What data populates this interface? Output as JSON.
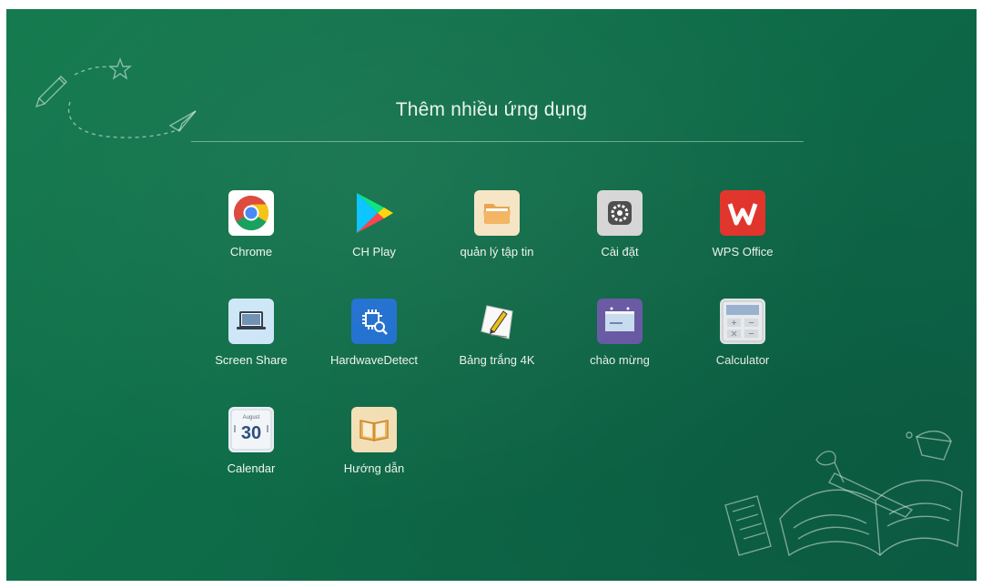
{
  "page": {
    "title": "Thêm nhiều ứng dụng"
  },
  "apps": [
    {
      "label": "Chrome",
      "icon": "chrome-icon"
    },
    {
      "label": "CH Play",
      "icon": "play-store-icon"
    },
    {
      "label": "quản lý tập tin",
      "icon": "folder-icon"
    },
    {
      "label": "Cài đặt",
      "icon": "settings-gear-icon"
    },
    {
      "label": "WPS Office",
      "icon": "wps-office-icon"
    },
    {
      "label": "Screen Share",
      "icon": "laptop-icon"
    },
    {
      "label": "HardwaveDetect",
      "icon": "chip-search-icon"
    },
    {
      "label": "Bảng trắng 4K",
      "icon": "whiteboard-pencil-icon"
    },
    {
      "label": "chào mừng",
      "icon": "welcome-board-icon"
    },
    {
      "label": "Calculator",
      "icon": "calculator-icon"
    },
    {
      "label": "Calendar",
      "icon": "calendar-icon",
      "calendar_month": "August",
      "calendar_day": "30"
    },
    {
      "label": "Hướng dẫn",
      "icon": "book-icon"
    }
  ],
  "colors": {
    "background": "#0f6f49",
    "chrome_red": "#db4437",
    "chrome_yellow": "#f4c20d",
    "chrome_green": "#0f9d58",
    "chrome_blue": "#4285f4",
    "wps_red": "#e5332a",
    "hardware_blue": "#1e6fd1",
    "folder_tan": "#f6d9a8",
    "welcome_purple": "#6a5aa8"
  }
}
